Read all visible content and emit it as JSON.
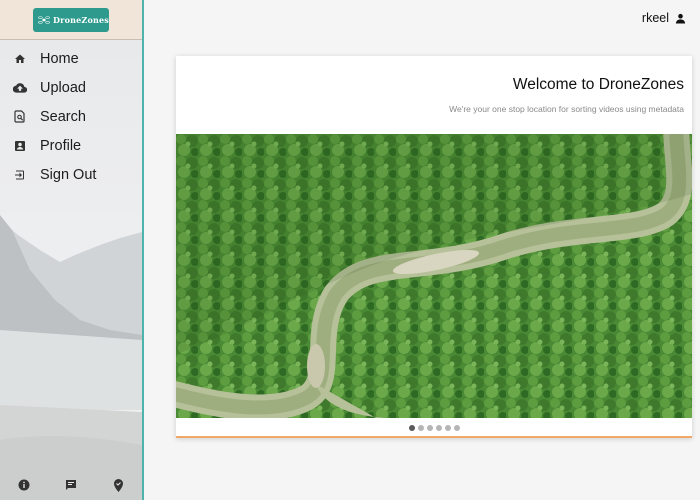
{
  "app": {
    "logo_text": "DroneZones"
  },
  "sidebar": {
    "items": [
      {
        "label": "Home",
        "icon": "home-icon"
      },
      {
        "label": "Upload",
        "icon": "cloud-upload-icon"
      },
      {
        "label": "Search",
        "icon": "search-document-icon"
      },
      {
        "label": "Profile",
        "icon": "account-box-icon"
      },
      {
        "label": "Sign Out",
        "icon": "sign-out-icon"
      }
    ],
    "bottom_icons": [
      "info-icon",
      "feedback-icon",
      "location-verified-icon"
    ]
  },
  "header": {
    "username": "rkeel",
    "user_icon": "person-icon"
  },
  "card": {
    "title": "Welcome to DroneZones",
    "subtitle": "We're your one stop location for sorting videos using metadata",
    "carousel": {
      "slide_count": 6,
      "active_index": 0
    }
  },
  "colors": {
    "accent": "#4fb3ad",
    "logo_bg": "#2e9a8e",
    "card_underline": "#f0a868"
  }
}
